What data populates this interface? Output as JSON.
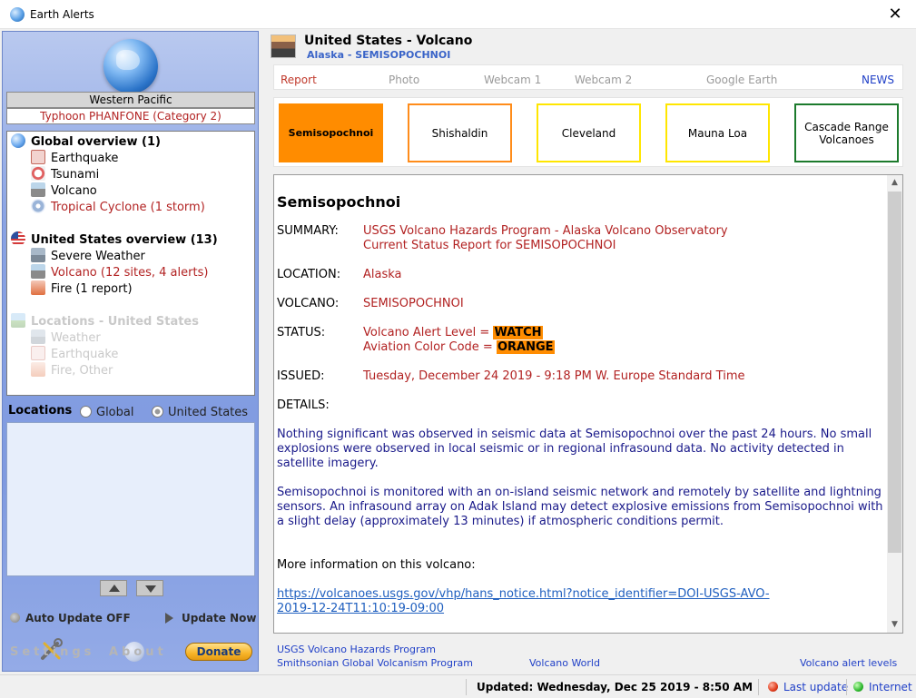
{
  "window": {
    "title": "Earth Alerts",
    "close_label": "✕"
  },
  "left": {
    "region": "Western Pacific",
    "storm": "Typhoon PHANFONE (Category 2)",
    "tree": {
      "global_overview": "Global overview (1)",
      "earthquake": "Earthquake",
      "tsunami": "Tsunami",
      "volcano": "Volcano",
      "tropical_cyclone": "Tropical Cyclone (1 storm)",
      "us_overview": "United States overview (13)",
      "severe_weather": "Severe Weather",
      "us_volcano": "Volcano (12 sites, 4 alerts)",
      "fire": "Fire (1 report)",
      "locations_us": "Locations - United States",
      "loc_weather": "Weather",
      "loc_earthquake": "Earthquake",
      "loc_fire": "Fire, Other"
    },
    "locations": {
      "label": "Locations",
      "radio_global": "Global",
      "radio_us": "United States",
      "selected": "United States"
    },
    "controls": {
      "auto_update": "Auto Update OFF",
      "update_now": "Update Now",
      "settings": "Settings",
      "about": "About",
      "donate": "Donate"
    }
  },
  "header": {
    "title": "United States - Volcano",
    "subtitle": "Alaska - SEMISOPOCHNOI"
  },
  "tabs": [
    {
      "label": "Report",
      "active": true
    },
    {
      "label": "Photo"
    },
    {
      "label": "Webcam 1"
    },
    {
      "label": "Webcam 2"
    },
    {
      "label": "Google Earth"
    },
    {
      "label": "NEWS"
    }
  ],
  "sites": [
    {
      "label": "Semisopochnoi",
      "color": "#ff8c00",
      "selected": true
    },
    {
      "label": "Shishaldin",
      "color": "#ff8c1a"
    },
    {
      "label": "Cleveland",
      "color": "#ffe600"
    },
    {
      "label": "Mauna Loa",
      "color": "#ffe600"
    },
    {
      "label": "Cascade Range Volcanoes",
      "color": "#1c7a2c"
    }
  ],
  "report": {
    "heading": "Semisopochnoi",
    "summary_label": "SUMMARY:",
    "summary_line1": "USGS Volcano Hazards Program - Alaska Volcano Observatory",
    "summary_line2": "Current Status Report for SEMISOPOCHNOI",
    "location_label": "LOCATION:",
    "location": "Alaska",
    "volcano_label": "VOLCANO:",
    "volcano": "SEMISOPOCHNOI",
    "status_label": "STATUS:",
    "alert_level_prefix": "Volcano Alert Level = ",
    "alert_level": "WATCH",
    "color_code_prefix": "Aviation Color Code = ",
    "color_code": "ORANGE",
    "issued_label": "ISSUED:",
    "issued": "Tuesday, December 24 2019 - 9:18 PM W. Europe Standard Time",
    "details_label": "DETAILS:",
    "details_1": "Nothing significant was observed in seismic data at Semisopochnoi over the past 24 hours. No small explosions were observed in local seismic or in regional infrasound data. No activity detected in satellite imagery.",
    "details_2": "Semisopochnoi is monitored with an on-island seismic network and remotely by satellite and lightning sensors. An infrasound array on Adak Island may detect explosive emissions from Semisopochnoi with a slight delay (approximately 13 minutes) if atmospheric conditions permit.",
    "more_info": "More information on this volcano:",
    "link": "https://volcanoes.usgs.gov/vhp/hans_notice.html?notice_identifier=DOI-USGS-AVO-2019-12-24T11:10:19-09:00"
  },
  "footer_links": {
    "usgs": "USGS Volcano Hazards Program",
    "smithsonian": "Smithsonian Global Volcanism Program",
    "volcano_world": "Volcano World",
    "alert_levels": "Volcano alert levels"
  },
  "status": {
    "updated": "Updated: Wednesday, Dec 25 2019 - 8:50 AM",
    "last_update": "Last update",
    "internet": "Internet"
  }
}
